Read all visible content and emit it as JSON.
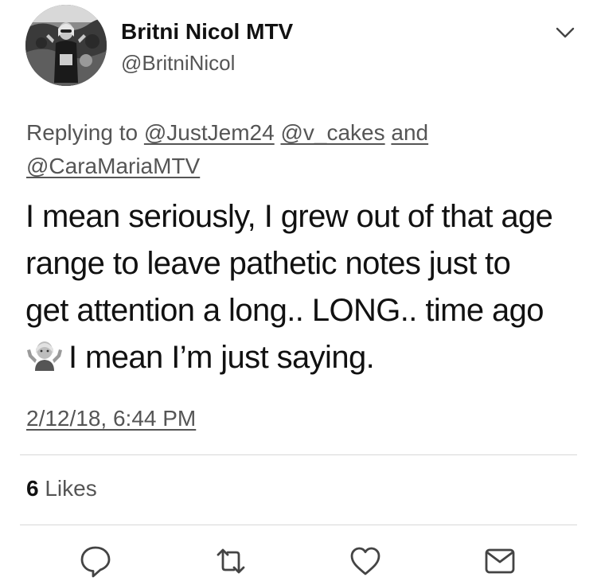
{
  "author": {
    "display_name": "Britni Nicol MTV",
    "handle": "@BritniNicol"
  },
  "reply": {
    "prefix": "Replying to ",
    "mentions": [
      "@JustJem24",
      "@v_cakes",
      "@CaraMariaMTV"
    ],
    "conjunction": "and"
  },
  "tweet": {
    "lines": [
      "I mean seriously, I grew out of that age",
      "range to leave pathetic notes just to",
      "get attention a long.. LONG.. time ago",
      "I mean I’m just saying."
    ],
    "emoji": "shrugging-person-emoji",
    "timestamp": "2/12/18, 6:44 PM"
  },
  "stats": {
    "likes_count": "6",
    "likes_label": "Likes"
  },
  "actions": {
    "icons": [
      "reply-icon",
      "retweet-icon",
      "like-icon",
      "message-icon"
    ]
  },
  "theme": {
    "text": "#111111",
    "secondary": "#555555",
    "divider": "#d8d8d8"
  }
}
